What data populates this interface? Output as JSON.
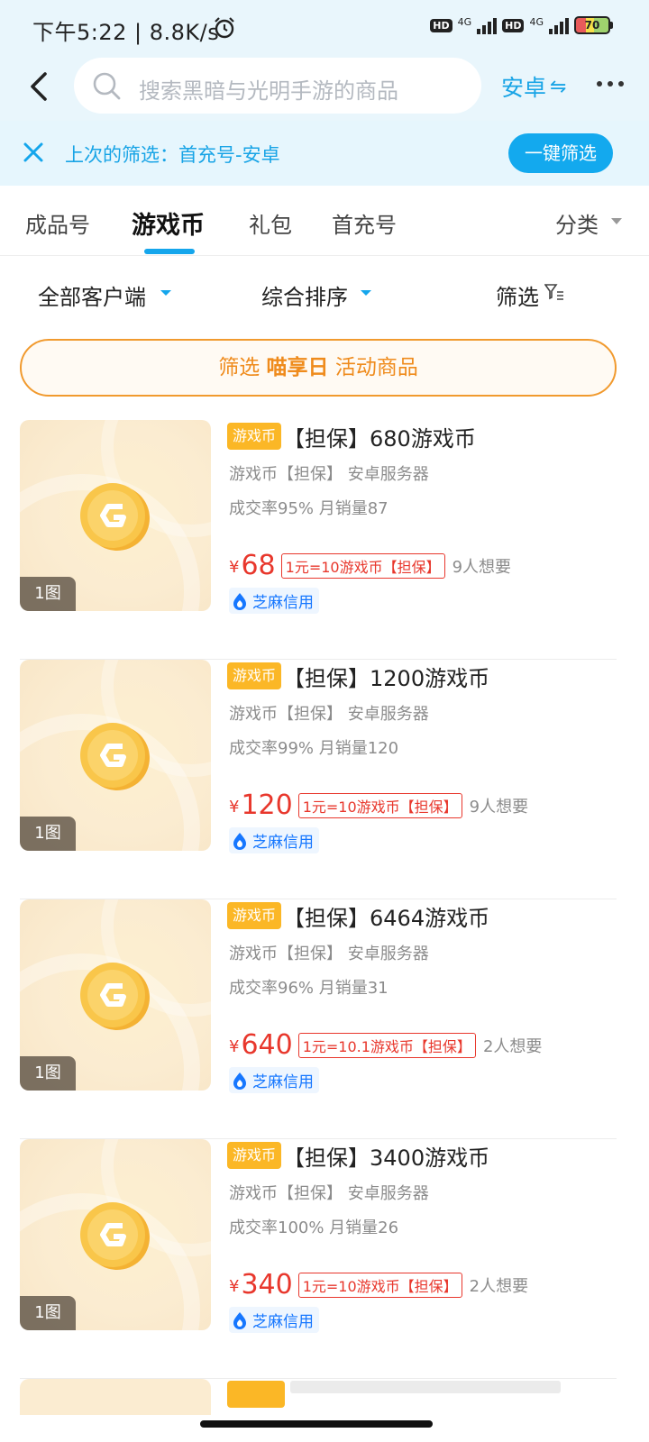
{
  "status_bar": {
    "time": "下午5:22 | 8.8K/s",
    "hd1": "HD",
    "net1": "4G",
    "hd2": "HD",
    "net2": "4G",
    "battery": "70"
  },
  "header": {
    "search_placeholder": "搜索黑暗与光明手游的商品",
    "platform_label": "安卓",
    "platform_icon": "⇋"
  },
  "last_filter": {
    "text": "上次的筛选：首充号-安卓",
    "button_label": "一键筛选"
  },
  "tabs": [
    {
      "label": "成品号",
      "active": false
    },
    {
      "label": "游戏币",
      "active": true
    },
    {
      "label": "礼包",
      "active": false
    },
    {
      "label": "首充号",
      "active": false
    }
  ],
  "category_label": "分类",
  "sort_bar": {
    "client": "全部客户端",
    "sort": "综合排序",
    "filter": "筛选"
  },
  "activity_banner": {
    "prefix": "筛选",
    "highlight": "喵享日",
    "suffix": "活动商品"
  },
  "items": [
    {
      "badge": "游戏币",
      "title": "【担保】680游戏币",
      "subtitle": "游戏币【担保】  安卓服务器",
      "stats": "成交率95% 月销量87",
      "currency": "¥",
      "price": "68",
      "rate": "1元=10游戏币【担保】",
      "want": "9人想要",
      "credit": "芝麻信用",
      "image_count": "1图"
    },
    {
      "badge": "游戏币",
      "title": "【担保】1200游戏币",
      "subtitle": "游戏币【担保】  安卓服务器",
      "stats": "成交率99% 月销量120",
      "currency": "¥",
      "price": "120",
      "rate": "1元=10游戏币【担保】",
      "want": "9人想要",
      "credit": "芝麻信用",
      "image_count": "1图"
    },
    {
      "badge": "游戏币",
      "title": "【担保】6464游戏币",
      "subtitle": "游戏币【担保】  安卓服务器",
      "stats": "成交率96% 月销量31",
      "currency": "¥",
      "price": "640",
      "rate": "1元=10.1游戏币【担保】",
      "want": "2人想要",
      "credit": "芝麻信用",
      "image_count": "1图"
    },
    {
      "badge": "游戏币",
      "title": "【担保】3400游戏币",
      "subtitle": "游戏币【担保】  安卓服务器",
      "stats": "成交率100% 月销量26",
      "currency": "¥",
      "price": "340",
      "rate": "1元=10游戏币【担保】",
      "want": "2人想要",
      "credit": "芝麻信用",
      "image_count": "1图"
    }
  ],
  "colors": {
    "accent": "#15a6ec",
    "price": "#e8372c",
    "badge": "#fbb726",
    "activity": "#f19a2e"
  }
}
